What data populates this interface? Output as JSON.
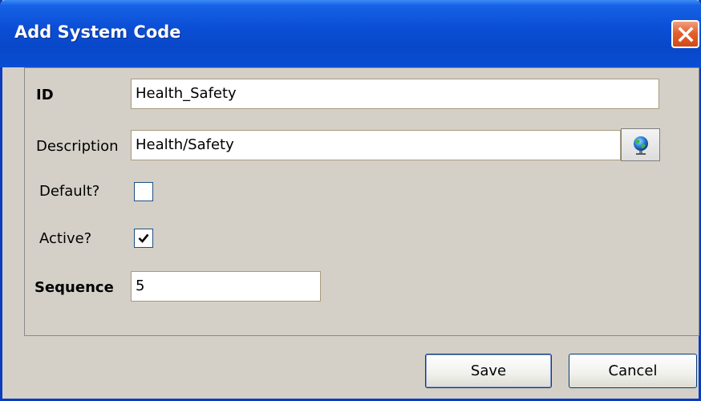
{
  "window": {
    "title": "Add System Code"
  },
  "form": {
    "id_label": "ID",
    "id_value": "Health_Safety",
    "description_label": "Description",
    "description_value": "Health/Safety",
    "default_label": "Default?",
    "default_checked": false,
    "active_label": "Active?",
    "active_checked": true,
    "sequence_label": "Sequence",
    "sequence_value": "5"
  },
  "buttons": {
    "save_label": "Save",
    "cancel_label": "Cancel"
  },
  "icons": {
    "close": "close-icon",
    "globe": "globe-icon",
    "check": "checkmark-icon"
  },
  "colors": {
    "titlebar": "#0b4fd6",
    "close_button": "#e6602e",
    "dialog_background": "#d4d0c8"
  }
}
